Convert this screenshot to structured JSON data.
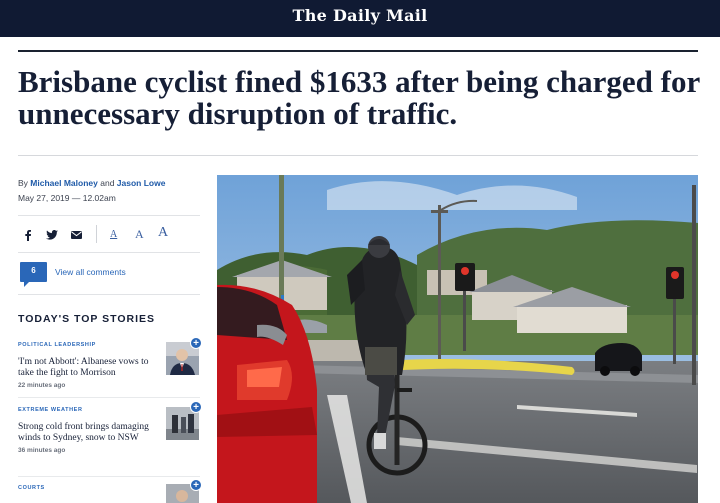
{
  "header": {
    "masthead": "The Daily Mail"
  },
  "article": {
    "headline": "Brisbane cyclist fined $1633 after being charged for unnecessary disruption of traffic.",
    "byline_prefix": "By",
    "author_1": "Michael Maloney",
    "byline_and": "and",
    "author_2": "Jason Lowe",
    "date": "May 27, 2019 — 12.02am"
  },
  "toolbar": {
    "font_small": "A",
    "font_medium": "A",
    "font_large": "A"
  },
  "comments": {
    "count": "6",
    "link_label": "View all comments"
  },
  "top_stories": {
    "heading": "TODAY'S TOP STORIES",
    "items": [
      {
        "category": "POLITICAL LEADERSHIP",
        "title": "'I'm not Abbott': Albanese vows to take the fight to Morrison",
        "time": "22 minutes ago"
      },
      {
        "category": "EXTREME WEATHER",
        "title": "Strong cold front brings damaging winds to Sydney, snow to NSW",
        "time": "36 minutes ago"
      },
      {
        "category": "COURTS",
        "title": "",
        "time": ""
      }
    ]
  },
  "colors": {
    "masthead_bg": "#101a33",
    "link_blue": "#2a67b8",
    "headline": "#161f36"
  }
}
